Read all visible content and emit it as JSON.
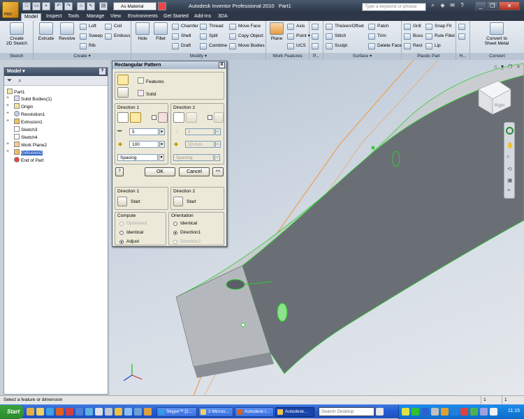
{
  "titlebar": {
    "app_icon_label": "PRO",
    "material": "As Material",
    "app_title": "Autodesk Inventor Professional 2010",
    "document": "Part1",
    "search_placeholder": "Type a keyword or phrase"
  },
  "tabs": [
    "Model",
    "Inspect",
    "Tools",
    "Manage",
    "View",
    "Environments",
    "Get Started",
    "Add-Ins",
    "3DA"
  ],
  "ribbon": {
    "sketch": {
      "title": "Sketch",
      "create_label": "Create\n2D Sketch"
    },
    "create": {
      "title": "Create ▾",
      "extrude": "Extrude",
      "revolve": "Revolve",
      "loft": "Loft",
      "coil": "Coil",
      "sweep": "Sweep",
      "emboss": "Emboss",
      "rib": "Rib"
    },
    "modify": {
      "title": "Modify ▾",
      "hole": "Hole",
      "fillet": "Fillet",
      "chamfer": "Chamfer",
      "thread": "Thread",
      "move_face": "Move Face",
      "shell": "Shell",
      "split": "Split",
      "copy_object": "Copy Object",
      "draft": "Draft",
      "combine": "Combine",
      "move_bodies": "Move Bodies"
    },
    "work_features": {
      "title": "Work Features",
      "plane": "Plane",
      "axis": "Axis",
      "point": "Point ▾",
      "ucs": "UCS"
    },
    "pattern": {
      "title": "P..."
    },
    "surface": {
      "title": "Surface ▾",
      "thicken": "Thicken/Offset",
      "patch": "Patch",
      "stitch": "Stitch",
      "trim": "Trim",
      "sculpt": "Sculpt",
      "delete_face": "Delete Face"
    },
    "plastic": {
      "title": "Plastic Part",
      "grill": "Grill",
      "snap_fit": "Snap Fit",
      "boss": "Boss",
      "rule_fillet": "Rule Fillet",
      "rest": "Rest",
      "lip": "Lip"
    },
    "harness": {
      "title": "H..."
    },
    "convert": {
      "title": "Convert",
      "label": "Convert to\nSheet Metal"
    }
  },
  "browser": {
    "title": "Model ▾",
    "help": "?",
    "items": [
      {
        "label": "Part1"
      },
      {
        "label": "Solid Bodies(1)"
      },
      {
        "label": "Origin"
      },
      {
        "label": "Revolution1"
      },
      {
        "label": "Extrusion1"
      },
      {
        "label": "Sketch3"
      },
      {
        "label": "Sketch4"
      },
      {
        "label": "Work Plane2"
      },
      {
        "label": "Extrusion2"
      },
      {
        "label": "End of Part"
      }
    ]
  },
  "dialog": {
    "title": "Rectangular Pattern",
    "close": "X",
    "features": "Features",
    "solid": "Solid",
    "dir1_title": "Direction 1",
    "dir2_title": "Direction 2",
    "count1": "5",
    "spacing1": "100",
    "type1": "Spacing",
    "count2": "2",
    "spacing2": "10 mm",
    "type2": "Spacing",
    "ok": "OK",
    "cancel": "Cancel",
    "more": "<<",
    "help": "?",
    "start_dir1_title": "Direction 1",
    "start_dir2_title": "Direction 2",
    "start1": "Start",
    "start2": "Start",
    "compute_title": "Compute",
    "optimized": "Optimized",
    "identical": "Identical",
    "adjust": "Adjust",
    "orientation_title": "Orientation",
    "orient_identical": "Identical",
    "direction1": "Direction1",
    "direction2": "Direction2"
  },
  "viewcube": {
    "face": "Right"
  },
  "status": {
    "message": "Select a feature or dimension",
    "count1": "1",
    "count2": "1"
  },
  "taskbar": {
    "start": "Start",
    "buttons": [
      "Skype™ [2...",
      "2 Micros...",
      "Autodesk I...",
      "Autodesk..."
    ],
    "search": "Search Desktop",
    "clock": "11:15"
  },
  "colors": {
    "accent": "#3166c5",
    "model_face": "#6a6f76",
    "model_top": "#c9ccd0",
    "highlight": "#2ecc2e",
    "workplane": "#e8a35a"
  }
}
